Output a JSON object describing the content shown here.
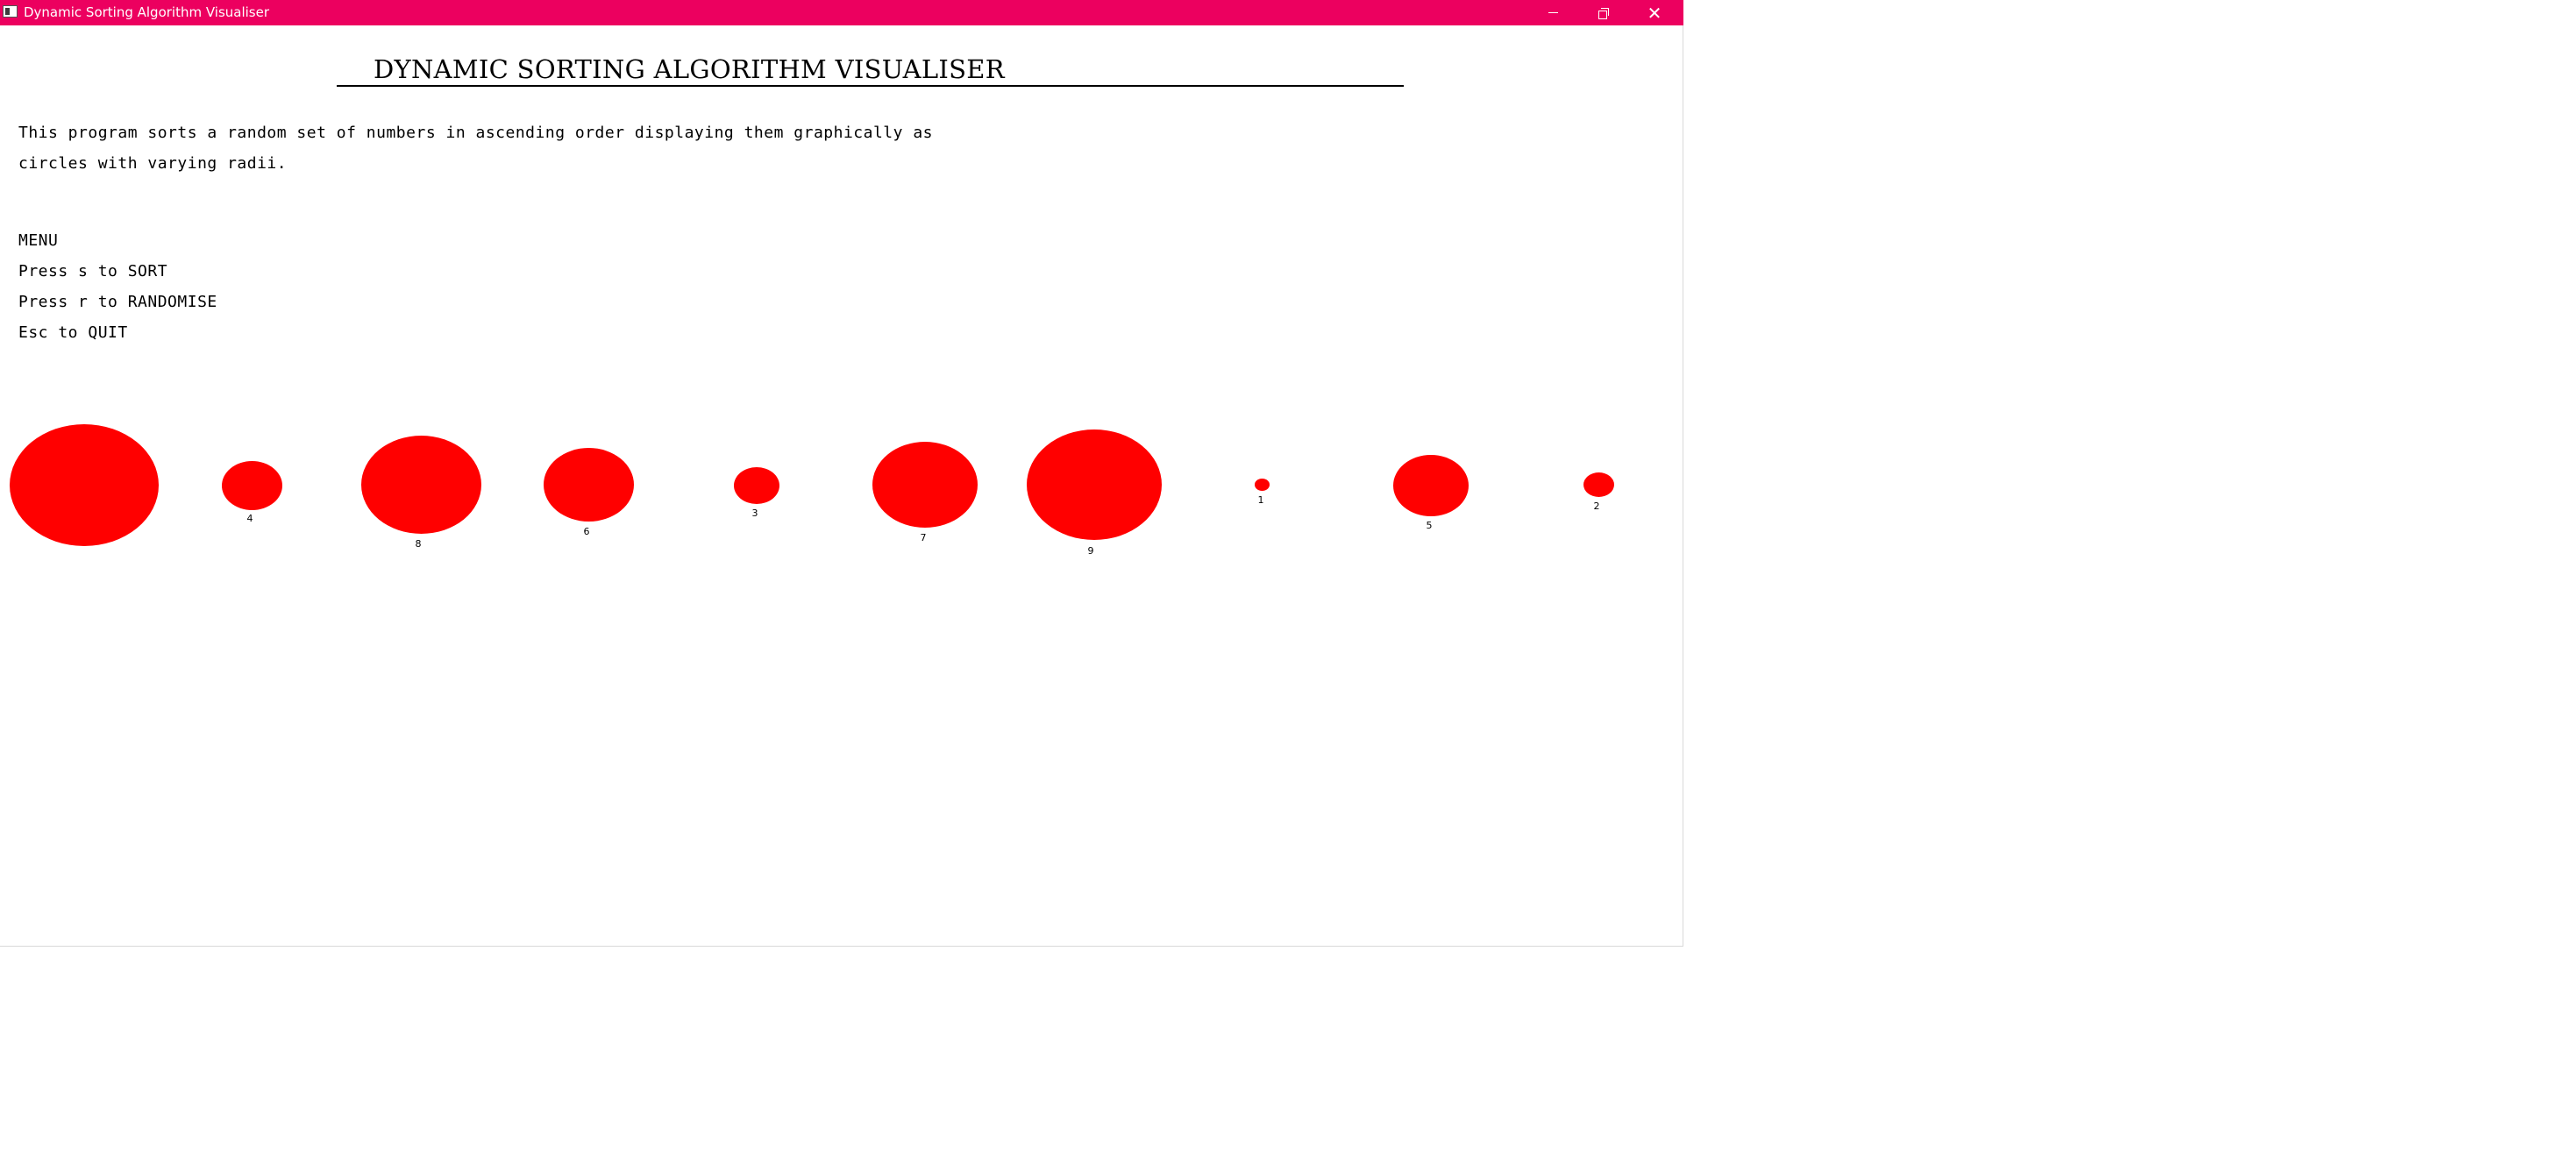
{
  "window": {
    "title": "Dynamic Sorting Algorithm Visualiser",
    "title_bar_color": "#ec005f",
    "icon": "app-window-icon",
    "controls": {
      "minimize_icon": "minimize-icon",
      "restore_icon": "restore-icon",
      "close_icon": "close-icon",
      "close_glyph": "✕"
    }
  },
  "content": {
    "heading": "DYNAMIC SORTING ALGORITHM VISUALISER",
    "description_line_1": "This program sorts a random set of numbers in ascending order displaying them graphically as",
    "description_line_2": "circles with varying radii.",
    "menu": {
      "title": "MENU",
      "items": [
        "Press s to SORT",
        "Press r to RANDOMISE",
        "Esc to QUIT"
      ]
    }
  },
  "visualisation": {
    "circle_color": "#ff0000",
    "circles": [
      {
        "label": ""
      },
      {
        "label": "4"
      },
      {
        "label": "8"
      },
      {
        "label": "6"
      },
      {
        "label": "3"
      },
      {
        "label": "7"
      },
      {
        "label": "9"
      },
      {
        "label": "1"
      },
      {
        "label": "5"
      },
      {
        "label": "2"
      }
    ]
  }
}
